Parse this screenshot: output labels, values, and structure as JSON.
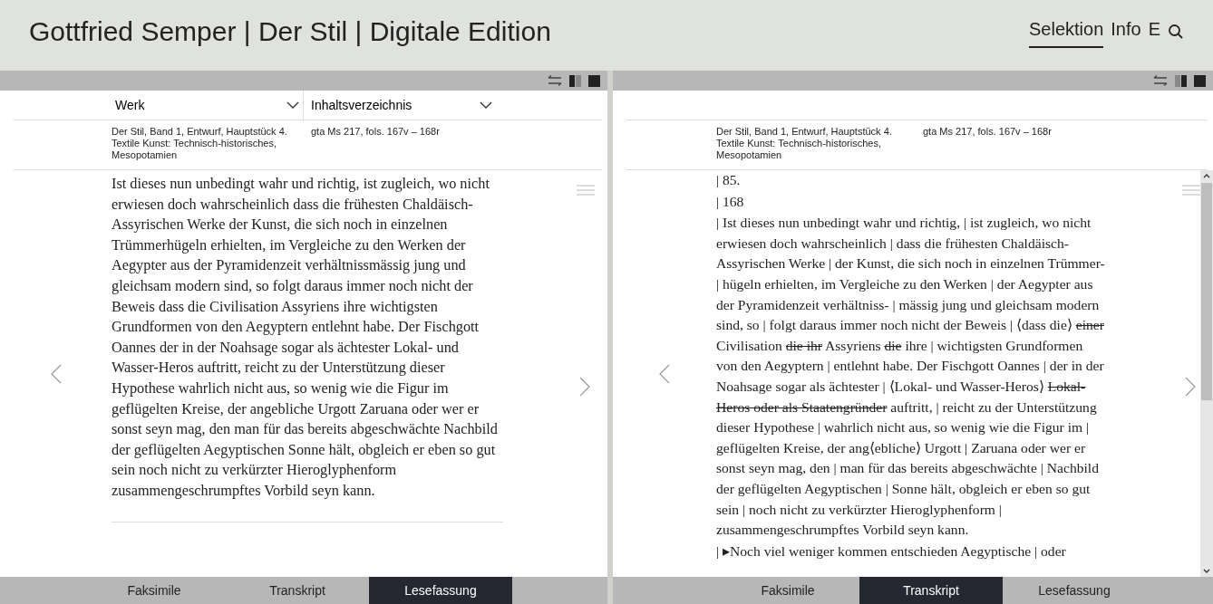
{
  "header": {
    "title": "Gottfried Semper | Der Stil | Digitale Edition",
    "nav": [
      {
        "label": "Selektion",
        "selected": true
      },
      {
        "label": "Info",
        "selected": false
      },
      {
        "label": "E",
        "selected": false
      }
    ]
  },
  "panes": [
    {
      "selectors": [
        {
          "label": "Werk"
        },
        {
          "label": "Inhaltsverzeichnis"
        }
      ],
      "meta": {
        "work": "Der Stil, Band 1, Entwurf, Hauptstück 4. Textile Kunst: Technisch-historisches, Mesopotamien",
        "source": "gta Ms 217, fols. 167v – 168r"
      },
      "paragraphs": [
        [
          {
            "text": "Ist dieses nun unbedingt wahr und richtig, ist zugleich, wo nicht erwiesen doch wahrscheinlich dass die frühesten Chaldäisch-Assyrischen Werke der Kunst, die sich noch in einzelnen Trümmerhügeln erhielten, im Vergleiche zu den Werken der Aegypter aus der Pyramidenzeit verhältnissmässig jung und gleichsam modern sind, so folgt daraus immer noch nicht der Beweis dass die Civilisation Assyriens ihre wichtigsten Grundformen von den Aegyptern entlehnt habe. Der Fischgott Oannes der in der Noahsage sogar als ächtester Lokal- und Wasser-Heros auftritt, reicht zu der Unterstützung dieser Hypothese wahrlich nicht aus, so wenig wie die Figur im geflügelten Kreise, der angebliche Urgott Zaruana oder wer er sonst seyn mag, den man für das bereits abgeschwächte Nachbild der geflügelten Aegyptischen Sonne hält, obgleich er eben so gut sein noch nicht zu verkürzter Hieroglyphenform zusammengeschrumpftes Vorbild seyn kann.",
            "deleted": false
          }
        ]
      ],
      "end_rule": true,
      "scrollbar": false,
      "tabs": [
        {
          "label": "Faksimile",
          "selected": false
        },
        {
          "label": "Transkript",
          "selected": false
        },
        {
          "label": "Lesefassung",
          "selected": true
        }
      ]
    },
    {
      "meta": {
        "work": "Der Stil, Band 1, Entwurf, Hauptstück 4. Textile Kunst: Technisch-historisches, Mesopotamien",
        "source": "gta Ms 217, fols. 167v – 168r"
      },
      "paragraphs": [
        [
          {
            "text": "| 85.",
            "deleted": false
          }
        ],
        [
          {
            "text": "| 168",
            "deleted": false
          }
        ],
        [
          {
            "text": "| Ist dieses nun unbedingt wahr und richtig, | ist zugleich, wo nicht erwiesen doch wahrscheinlich | dass die frühesten Chaldäisch-Assyrischen Werke | der Kunst, die sich noch in einzelnen Trümmer- | hügeln erhielten, im Vergleiche zu den Werken | der Aegypter aus der Pyramidenzeit verhältniss- | mässig jung und gleichsam modern sind, so | folgt daraus immer noch nicht der Beweis | ⟨dass die⟩ ",
            "deleted": false
          },
          {
            "text": "einer",
            "deleted": true
          },
          {
            "text": " Civilisation ",
            "deleted": false
          },
          {
            "text": "die ihr",
            "deleted": true
          },
          {
            "text": " Assyriens ",
            "deleted": false
          },
          {
            "text": "die",
            "deleted": true
          },
          {
            "text": " ihre | wichtigsten Grundformen von den Aegyptern | entlehnt habe. Der Fischgott Oannes | der in der Noahsage sogar als ächtester | ⟨Lokal- und Wasser-Heros⟩ ",
            "deleted": false
          },
          {
            "text": "Lokal-Heros oder als Staatengründer",
            "deleted": true
          },
          {
            "text": " auftritt, | reicht zu der Unterstützung dieser Hypothese | wahrlich nicht aus, so wenig wie die Figur im | geflügelten Kreise, der ang⟨ebliche⟩ Urgott | Zaruana oder wer er sonst seyn mag, den | man für das bereits abgeschwächte | Nachbild der geflügelten Aegyptischen | Sonne hält, obgleich er eben so gut sein | noch nicht zu verkürzter Hieroglyphenform | zusammengeschrumpftes Vorbild seyn kann.",
            "deleted": false
          }
        ],
        [
          {
            "text": "| ▸Noch viel weniger kommen entschieden Aegyptische | oder",
            "deleted": false
          }
        ]
      ],
      "end_rule": false,
      "scrollbar": true,
      "tabs": [
        {
          "label": "Faksimile",
          "selected": false
        },
        {
          "label": "Transkript",
          "selected": true
        },
        {
          "label": "Lesefassung",
          "selected": false
        }
      ]
    }
  ]
}
